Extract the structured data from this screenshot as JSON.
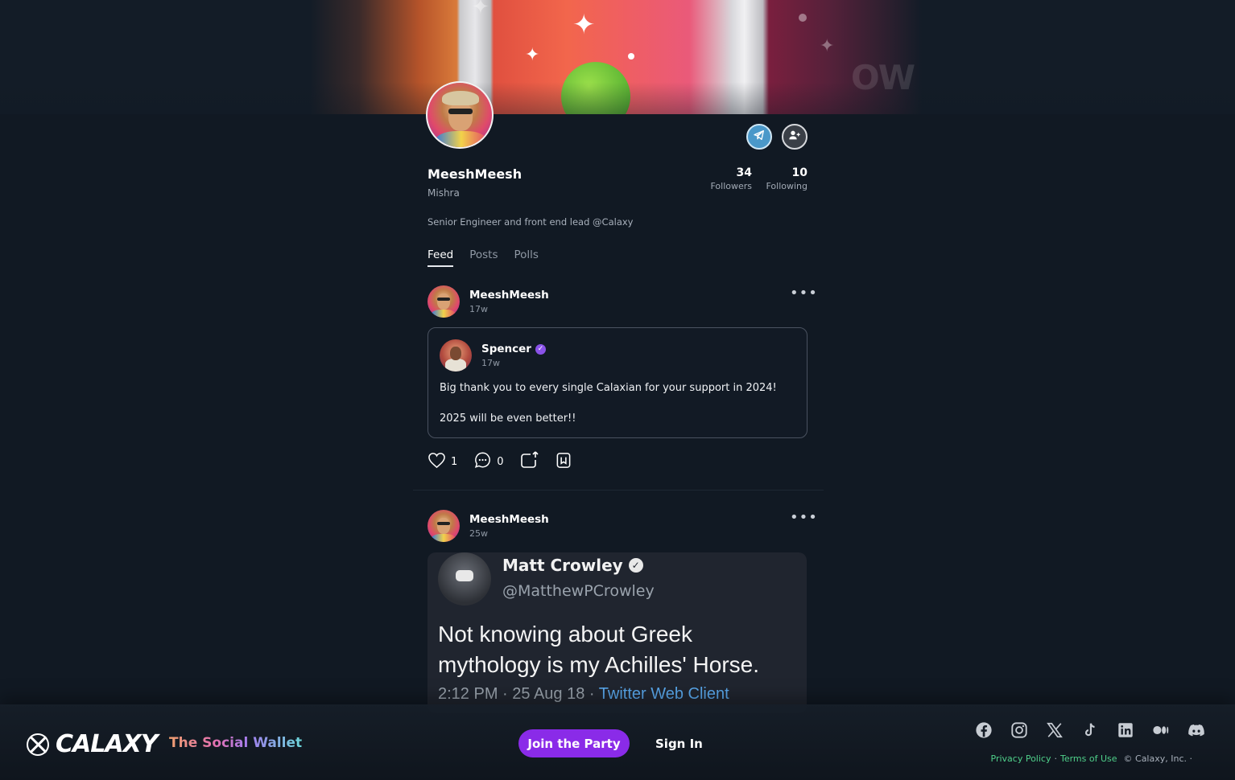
{
  "profile": {
    "display_name": "MeeshMeesh",
    "real_name": "Mishra",
    "bio": "Senior Engineer and front end lead @Calaxy",
    "followers_count": "34",
    "followers_label": "Followers",
    "following_count": "10",
    "following_label": "Following"
  },
  "banner": {
    "text": "OW"
  },
  "tabs": [
    {
      "label": "Feed",
      "active": true
    },
    {
      "label": "Posts",
      "active": false
    },
    {
      "label": "Polls",
      "active": false
    }
  ],
  "posts": [
    {
      "author": "MeeshMeesh",
      "time": "17w",
      "quote": {
        "author": "Spencer",
        "time": "17w",
        "line1": "Big thank you to every single Calaxian for your support in 2024!",
        "line2": "2025 will be even better!!"
      },
      "likes": "1",
      "comments": "0"
    },
    {
      "author": "MeeshMeesh",
      "time": "25w",
      "image": {
        "name": "Matt Crowley",
        "handle": "@MatthewPCrowley",
        "body_line1": "Not knowing about Greek",
        "body_line2": "mythology is my Achilles' Horse.",
        "meta": "2:12 PM · 25 Aug 18 · ",
        "client": "Twitter Web Client"
      }
    }
  ],
  "footer": {
    "logo": "CALAXY",
    "tagline": "The Social Wallet",
    "join_label": "Join the Party",
    "signin_label": "Sign In",
    "privacy": "Privacy Policy",
    "sep": "·",
    "terms": "Terms of Use",
    "copyright": "© Calaxy, Inc. ·"
  },
  "colors": {
    "background": "#111923",
    "accent_purple": "#8a2be8",
    "link_green": "#4fd08a",
    "telegram_blue": "#4a98c9",
    "verified_purple": "#8a52e8"
  },
  "icons": [
    "telegram-icon",
    "add-user-icon",
    "more-icon",
    "heart-icon",
    "comment-icon",
    "share-icon",
    "bookmark-icon",
    "verified-icon",
    "facebook-icon",
    "instagram-icon",
    "x-icon",
    "tiktok-icon",
    "linkedin-icon",
    "medium-icon",
    "discord-icon"
  ]
}
